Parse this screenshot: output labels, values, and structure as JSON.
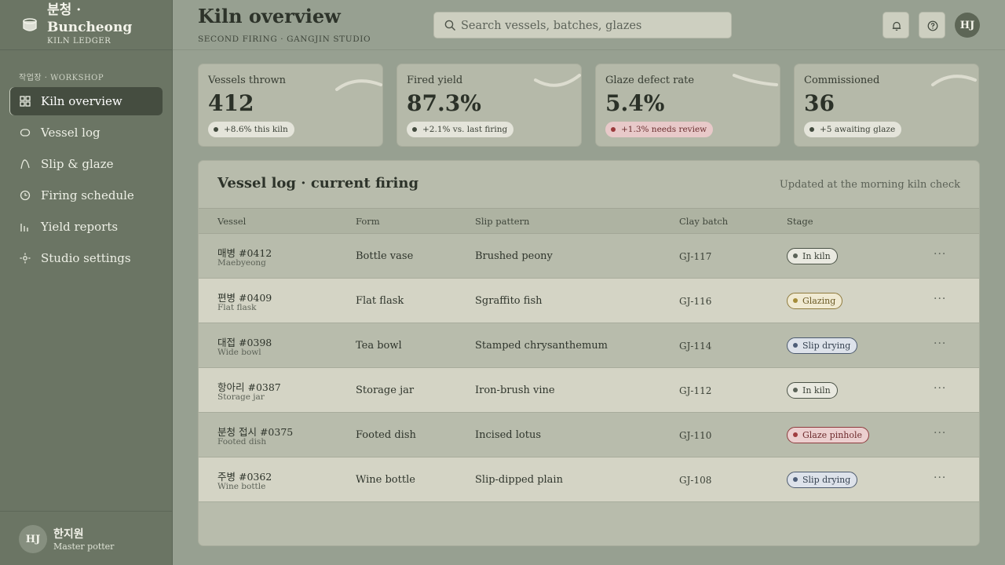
{
  "brand": {
    "title": "분청 · Buncheong",
    "subtitle": "KILN LEDGER"
  },
  "sidebar": {
    "section_label": "작업장 · WORKSHOP",
    "items": [
      {
        "label": "Kiln overview",
        "icon": "grid-icon",
        "active": true
      },
      {
        "label": "Vessel log",
        "icon": "vessel-icon"
      },
      {
        "label": "Slip & glaze",
        "icon": "brush-icon"
      },
      {
        "label": "Firing schedule",
        "icon": "clock-icon"
      },
      {
        "label": "Yield reports",
        "icon": "bar-chart-icon"
      },
      {
        "label": "Studio settings",
        "icon": "gear-icon"
      }
    ],
    "user": {
      "initials": "HJ",
      "name": "한지원",
      "role": "Master potter"
    }
  },
  "header": {
    "title": "Kiln overview",
    "subtitle": "SECOND FIRING · GANGJIN STUDIO",
    "search_placeholder": "Search vessels, batches, glazes",
    "avatar_initials": "HJ"
  },
  "stats": [
    {
      "label": "Vessels thrown",
      "value": "412",
      "badge": "+8.6% this kiln",
      "tone": "neutral"
    },
    {
      "label": "Fired yield",
      "value": "87.3%",
      "badge": "+2.1% vs. last firing",
      "tone": "neutral"
    },
    {
      "label": "Glaze defect rate",
      "value": "5.4%",
      "badge": "+1.3% needs review",
      "tone": "warn"
    },
    {
      "label": "Commissioned",
      "value": "36",
      "badge": "+5 awaiting glaze",
      "tone": "neutral"
    }
  ],
  "table": {
    "title": "Vessel log · current firing",
    "note": "Updated at the morning kiln check",
    "columns": [
      "Vessel",
      "Form",
      "Slip pattern",
      "Clay batch",
      "Stage"
    ],
    "rows": [
      {
        "vessel": "매병 #0412",
        "vessel_sub": "Maebyeong",
        "form": "Bottle vase",
        "pattern": "Brushed peony",
        "batch": "GJ-117",
        "stage": "In kiln",
        "stage_type": "kiln"
      },
      {
        "vessel": "편병 #0409",
        "vessel_sub": "Flat flask",
        "form": "Flat flask",
        "pattern": "Sgraffito fish",
        "batch": "GJ-116",
        "stage": "Glazing",
        "stage_type": "glazing"
      },
      {
        "vessel": "대접 #0398",
        "vessel_sub": "Wide bowl",
        "form": "Tea bowl",
        "pattern": "Stamped chrysanthemum",
        "batch": "GJ-114",
        "stage": "Slip drying",
        "stage_type": "drying"
      },
      {
        "vessel": "항아리 #0387",
        "vessel_sub": "Storage jar",
        "form": "Storage jar",
        "pattern": "Iron-brush vine",
        "batch": "GJ-112",
        "stage": "In kiln",
        "stage_type": "kiln"
      },
      {
        "vessel": "분청 접시 #0375",
        "vessel_sub": "Footed dish",
        "form": "Footed dish",
        "pattern": "Incised lotus",
        "batch": "GJ-110",
        "stage": "Glaze pinhole",
        "stage_type": "pinhole"
      },
      {
        "vessel": "주병 #0362",
        "vessel_sub": "Wine bottle",
        "form": "Wine bottle",
        "pattern": "Slip-dipped plain",
        "batch": "GJ-108",
        "stage": "Slip drying",
        "stage_type": "drying"
      }
    ],
    "more_label": "···"
  }
}
